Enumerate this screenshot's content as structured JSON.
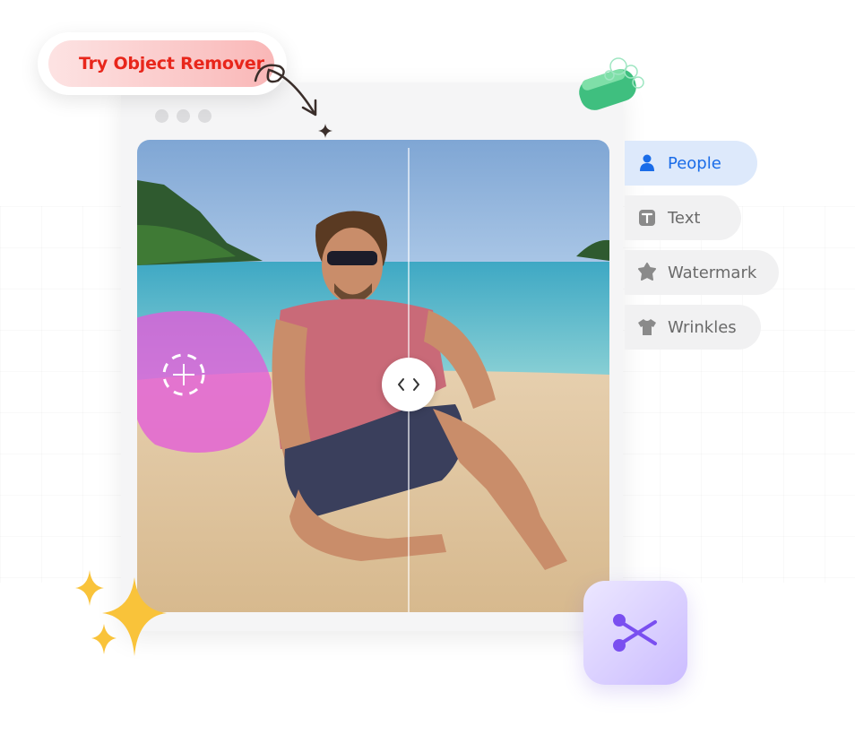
{
  "cta": {
    "label": "Try Object Remover"
  },
  "categories": [
    {
      "label": "People",
      "icon": "person-icon",
      "active": true
    },
    {
      "label": "Text",
      "icon": "text-icon",
      "active": false
    },
    {
      "label": "Watermark",
      "icon": "watermark-icon",
      "active": false
    },
    {
      "label": "Wrinkles",
      "icon": "shirt-icon",
      "active": false
    }
  ],
  "colors": {
    "cta_text": "#e8261b",
    "active_category": "#1a6ce8",
    "selection_mask": "#e35bd8",
    "scissor_accent": "#7a4ff0"
  },
  "icons": {
    "compare": "compare-arrows-icon",
    "tool": "scissors-icon",
    "decor": [
      "soap-icon",
      "sparkle-icon",
      "curly-arrow-icon"
    ]
  }
}
